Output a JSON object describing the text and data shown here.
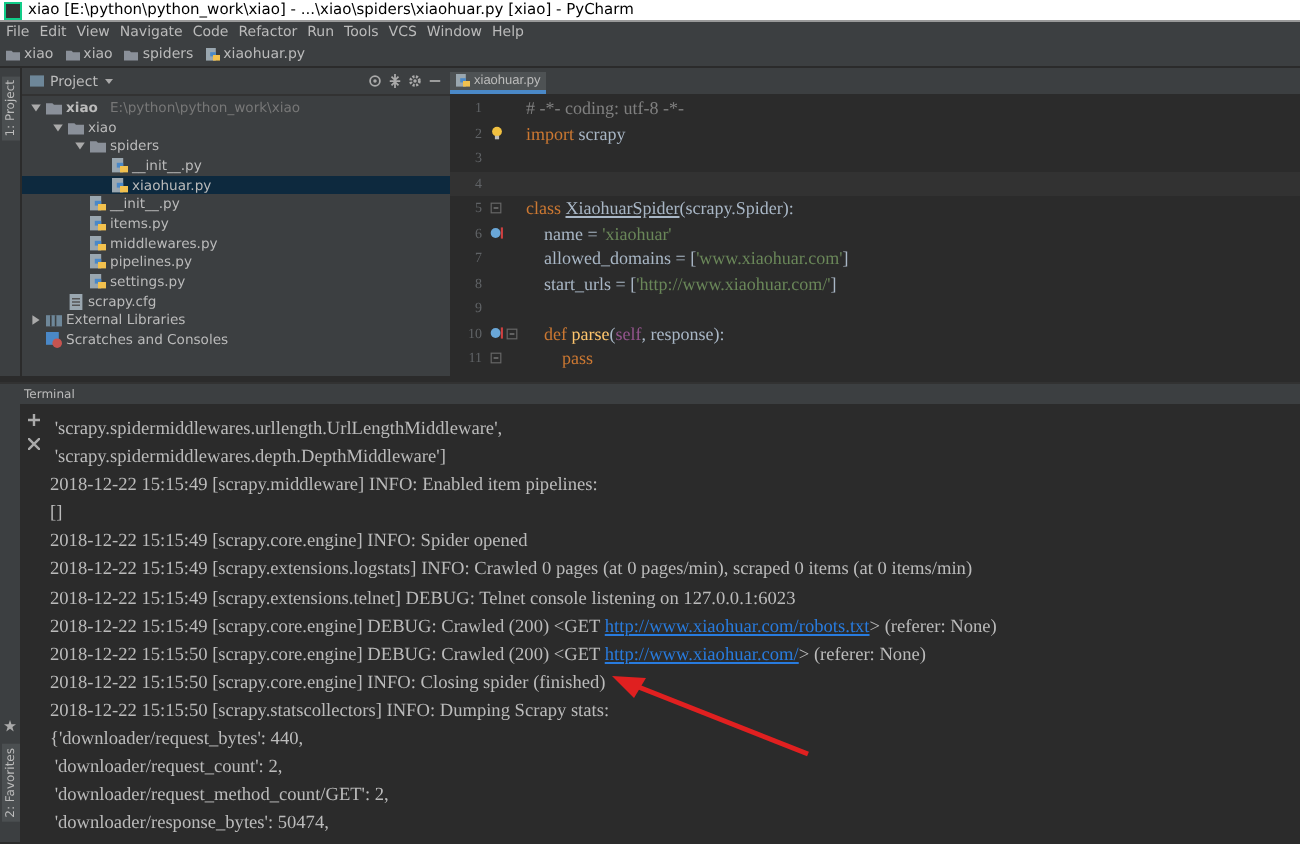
{
  "window": {
    "title": "xiao [E:\\python\\python_work\\xiao] - ...\\xiao\\spiders\\xiaohuar.py [xiao] - PyCharm"
  },
  "menu": [
    "File",
    "Edit",
    "View",
    "Navigate",
    "Code",
    "Refactor",
    "Run",
    "Tools",
    "VCS",
    "Window",
    "Help"
  ],
  "breadcrumbs": [
    {
      "label": "xiao",
      "kind": "folder"
    },
    {
      "label": "xiao",
      "kind": "folder"
    },
    {
      "label": "spiders",
      "kind": "folder"
    },
    {
      "label": "xiaohuar.py",
      "kind": "python"
    }
  ],
  "side_tabs": {
    "top": "1: Project",
    "bottom": "2: Favorites"
  },
  "project": {
    "title": "Project",
    "tree": [
      {
        "label": "xiao",
        "path": "E:\\python\\python_work\\xiao",
        "kind": "folder",
        "expanded": true,
        "selected": false,
        "children": [
          {
            "label": "xiao",
            "kind": "folder",
            "expanded": true,
            "selected": false,
            "children": [
              {
                "label": "spiders",
                "kind": "folder",
                "expanded": true,
                "selected": false,
                "children": [
                  {
                    "label": "__init__.py",
                    "kind": "python",
                    "selected": false
                  },
                  {
                    "label": "xiaohuar.py",
                    "kind": "python",
                    "selected": true
                  }
                ]
              },
              {
                "label": "__init__.py",
                "kind": "python",
                "selected": false
              },
              {
                "label": "items.py",
                "kind": "python",
                "selected": false
              },
              {
                "label": "middlewares.py",
                "kind": "python",
                "selected": false
              },
              {
                "label": "pipelines.py",
                "kind": "python",
                "selected": false
              },
              {
                "label": "settings.py",
                "kind": "python",
                "selected": false
              }
            ]
          },
          {
            "label": "scrapy.cfg",
            "kind": "cfg",
            "selected": false
          }
        ]
      },
      {
        "label": "External Libraries",
        "kind": "library",
        "expanded": false,
        "selected": false
      },
      {
        "label": "Scratches and Consoles",
        "kind": "scratch",
        "selected": false
      }
    ]
  },
  "editor": {
    "tab": {
      "label": "xiaohuar.py",
      "selected": true
    },
    "lines": [
      {
        "number": "1",
        "tokens": [
          {
            "text": "# -*- coding: utf-8 -*-",
            "kind": "comment"
          }
        ]
      },
      {
        "number": "2",
        "bulb": true,
        "tokens": [
          {
            "text": "import",
            "kind": "keyword"
          },
          {
            "text": " scrapy",
            "kind": "plain"
          }
        ]
      },
      {
        "number": "3"
      },
      {
        "number": "4"
      },
      {
        "number": "5",
        "fold": true,
        "tokens": [
          {
            "text": "class ",
            "kind": "keyword"
          },
          {
            "text": "XiaohuarSpider",
            "kind": "underlined"
          },
          {
            "text": "(scrapy.Spider):",
            "kind": "plain"
          }
        ]
      },
      {
        "number": "6",
        "override": true,
        "tokens": [
          {
            "text": "    name = ",
            "kind": "plain"
          },
          {
            "text": "'xiaohuar'",
            "kind": "string"
          }
        ]
      },
      {
        "number": "7",
        "tokens": [
          {
            "text": "    allowed_domains = [",
            "kind": "plain"
          },
          {
            "text": "'www.xiaohuar.com'",
            "kind": "string"
          },
          {
            "text": "]",
            "kind": "plain"
          }
        ]
      },
      {
        "number": "8",
        "tokens": [
          {
            "text": "    start_urls = [",
            "kind": "plain"
          },
          {
            "text": "'http://www.xiaohuar.com/'",
            "kind": "string"
          },
          {
            "text": "]",
            "kind": "plain"
          }
        ]
      },
      {
        "number": "9"
      },
      {
        "number": "10",
        "override": true,
        "fold": true,
        "tokens": [
          {
            "text": "    def ",
            "kind": "keyword"
          },
          {
            "text": "parse",
            "kind": "func"
          },
          {
            "text": "(",
            "kind": "plain"
          },
          {
            "text": "self",
            "kind": "self"
          },
          {
            "text": ", response):",
            "kind": "plain"
          }
        ]
      },
      {
        "number": "11",
        "fold": true,
        "tokens": [
          {
            "text": "        pass",
            "kind": "keyword"
          }
        ]
      }
    ]
  },
  "terminal": {
    "title": "Terminal",
    "lines": [
      [
        {
          "text": " 'scrapy.spidermiddlewares.urllength.UrlLengthMiddleware',",
          "kind": "plain"
        }
      ],
      [
        {
          "text": " 'scrapy.spidermiddlewares.depth.DepthMiddleware']",
          "kind": "plain"
        }
      ],
      [
        {
          "text": "2018-12-22 15:15:49 [scrapy.middleware] INFO: Enabled item pipelines:",
          "kind": "plain"
        }
      ],
      [
        {
          "text": "[]",
          "kind": "plain"
        }
      ],
      [
        {
          "text": "2018-12-22 15:15:49 [scrapy.core.engine] INFO: Spider opened",
          "kind": "plain"
        }
      ],
      [
        {
          "text": "2018-12-22 15:15:49 [scrapy.extensions.logstats] INFO: Crawled 0 pages (at 0 pages/min), scraped 0 items (at 0 items/min)",
          "kind": "plain"
        }
      ],
      [
        {
          "text": "2018-12-22 15:15:49 [scrapy.extensions.telnet] DEBUG: Telnet console listening on 127.0.0.1:6023",
          "kind": "plain"
        }
      ],
      [
        {
          "text": "2018-12-22 15:15:49 [scrapy.core.engine] DEBUG: Crawled (200) <GET ",
          "kind": "plain"
        },
        {
          "text": "http://www.xiaohuar.com/robots.txt",
          "kind": "link"
        },
        {
          "text": "> (referer: None)",
          "kind": "plain"
        }
      ],
      [
        {
          "text": "2018-12-22 15:15:50 [scrapy.core.engine] DEBUG: Crawled (200) <GET ",
          "kind": "plain"
        },
        {
          "text": "http://www.xiaohuar.com/",
          "kind": "link"
        },
        {
          "text": "> (referer: None)",
          "kind": "plain"
        }
      ],
      [
        {
          "text": "2018-12-22 15:15:50 [scrapy.core.engine] INFO: Closing spider (finished)",
          "kind": "plain"
        }
      ],
      [
        {
          "text": "2018-12-22 15:15:50 [scrapy.statscollectors] INFO: Dumping Scrapy stats:",
          "kind": "plain"
        }
      ],
      [
        {
          "text": "{'downloader/request_bytes': 440,",
          "kind": "plain"
        }
      ],
      [
        {
          "text": " 'downloader/request_count': 2,",
          "kind": "plain"
        }
      ],
      [
        {
          "text": " 'downloader/request_method_count/GET': 2,",
          "kind": "plain"
        }
      ],
      [
        {
          "text": " 'downloader/response_bytes': 50474,",
          "kind": "plain"
        }
      ]
    ]
  }
}
